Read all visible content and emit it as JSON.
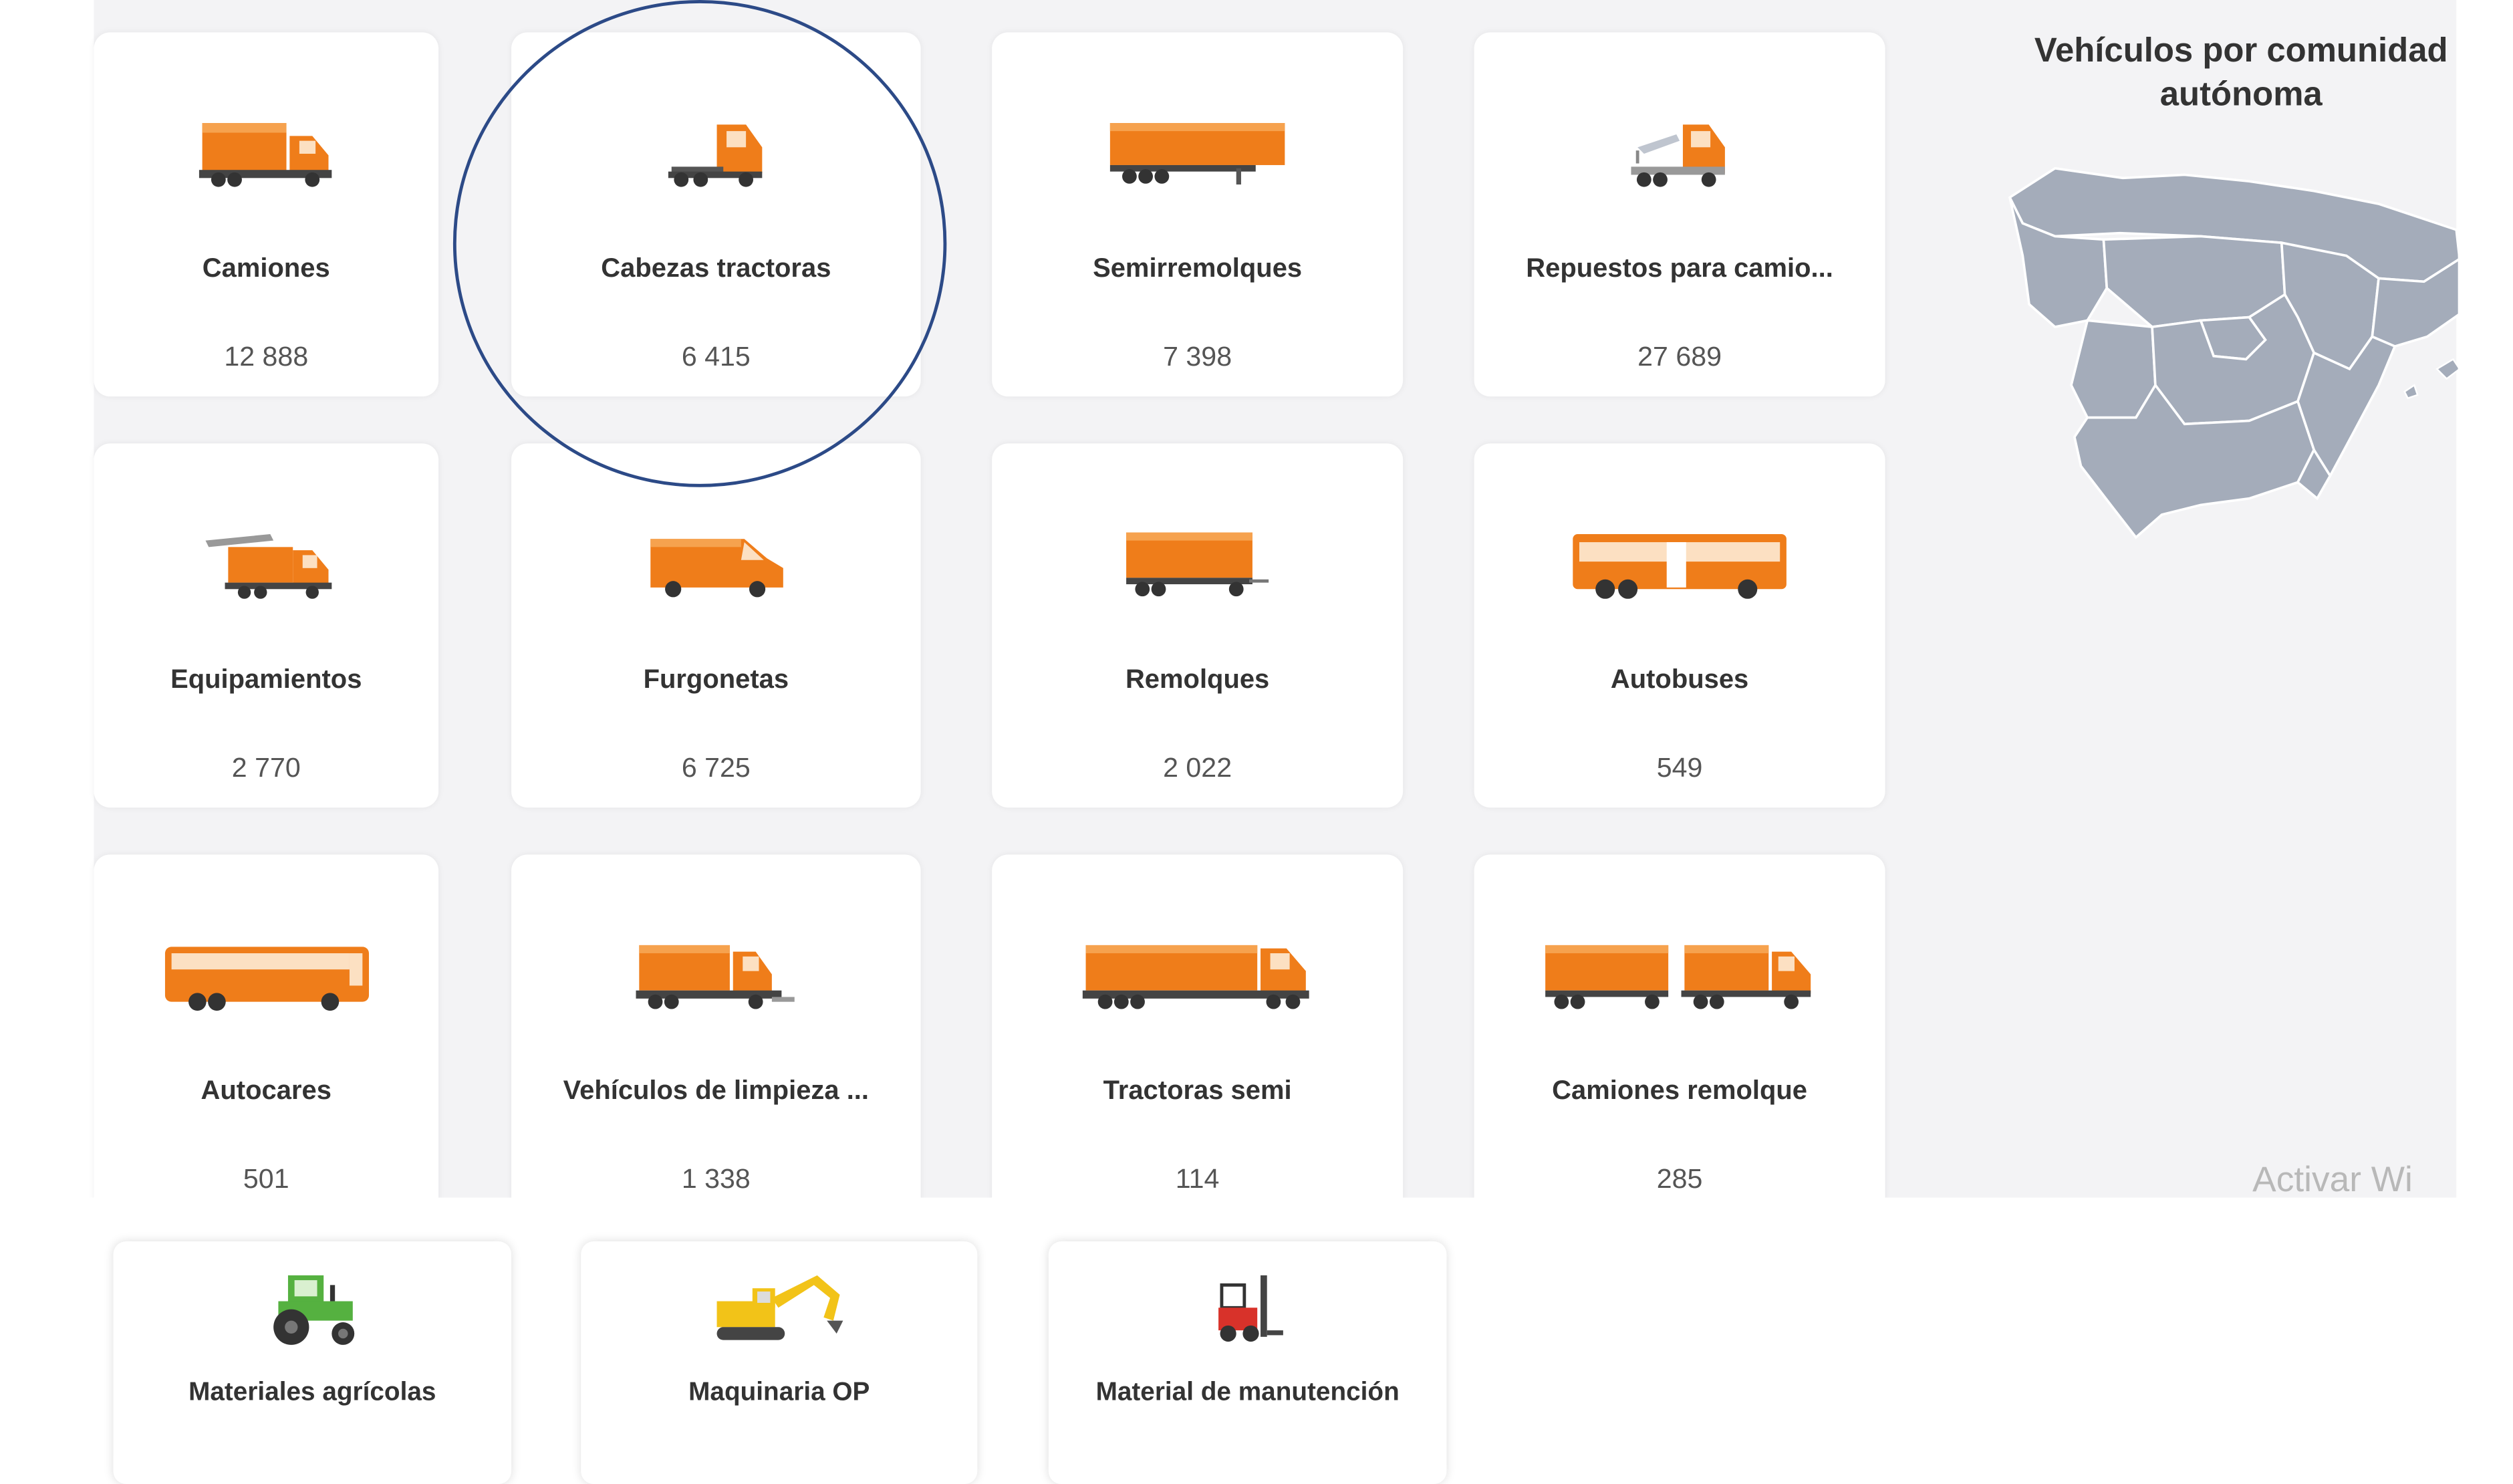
{
  "categories": [
    {
      "label": "Camiones",
      "count": "12 888",
      "icon": "truck-icon"
    },
    {
      "label": "Cabezas tractoras",
      "count": "6 415",
      "icon": "tractor-head-icon"
    },
    {
      "label": "Semirremolques",
      "count": "7 398",
      "icon": "semitrailer-icon"
    },
    {
      "label": "Repuestos para camio...",
      "count": "27 689",
      "icon": "tow-truck-icon"
    },
    {
      "label": "Equipamientos",
      "count": "2 770",
      "icon": "equipment-truck-icon"
    },
    {
      "label": "Furgonetas",
      "count": "6 725",
      "icon": "van-icon"
    },
    {
      "label": "Remolques",
      "count": "2 022",
      "icon": "trailer-icon"
    },
    {
      "label": "Autobuses",
      "count": "549",
      "icon": "bus-icon"
    },
    {
      "label": "Autocares",
      "count": "501",
      "icon": "coach-icon"
    },
    {
      "label": "Vehículos de limpieza ...",
      "count": "1 338",
      "icon": "cleaning-truck-icon"
    },
    {
      "label": "Tractoras semi",
      "count": "114",
      "icon": "truck-semitrailer-icon"
    },
    {
      "label": "Camiones remolque",
      "count": "285",
      "icon": "truck-trailer-icon"
    }
  ],
  "bottom_categories": [
    {
      "label": "Materiales agrícolas",
      "icon": "tractor-icon"
    },
    {
      "label": "Maquinaria OP",
      "icon": "excavator-icon"
    },
    {
      "label": "Material de manutención",
      "icon": "forklift-icon"
    }
  ],
  "map": {
    "title_line1": "Vehículos por comunidad",
    "title_line2": "autónoma",
    "fill": "#a4acba",
    "border": "#ffffff"
  },
  "watermark": "Activar Wi",
  "colors": {
    "accent": "#ef7d1a",
    "accent_dark": "#d8650a",
    "wheel": "#333333",
    "highlight_circle": "#2c4a87"
  }
}
